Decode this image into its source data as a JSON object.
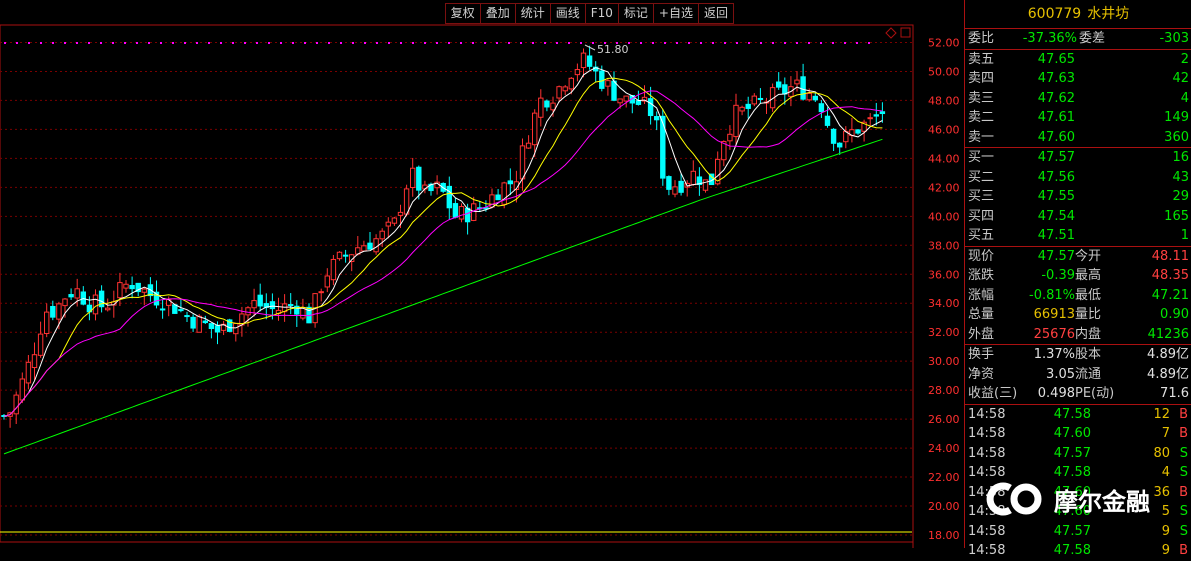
{
  "toolbar": {
    "buttons": [
      "复权",
      "叠加",
      "统计",
      "画线",
      "F10",
      "标记",
      "+自选",
      "返回"
    ]
  },
  "chart_data": {
    "type": "candlestick",
    "price_ticks": [
      "52.00",
      "50.00",
      "48.00",
      "46.00",
      "44.00",
      "42.00",
      "40.00",
      "38.00",
      "36.00",
      "34.00",
      "32.00",
      "30.00",
      "28.00",
      "26.00",
      "24.00",
      "22.00",
      "20.00",
      "18.00"
    ],
    "ylim": [
      18,
      53
    ],
    "high_label": "51.80",
    "colors": {
      "up": "#ff3232",
      "down": "#00ffff",
      "ma5": "#ffffff",
      "ma10": "#ffff00",
      "ma20": "#ff00ff",
      "ma60": "#00ff00",
      "grid": "#7a0000"
    }
  },
  "panel": {
    "code": "600779",
    "name": "水井坊",
    "weibi_label": "委比",
    "weibi": "-37.36%",
    "weicha_label": "委差",
    "weicha": "-303",
    "sell": [
      {
        "label": "卖五",
        "price": "47.65",
        "vol": "2"
      },
      {
        "label": "卖四",
        "price": "47.63",
        "vol": "42"
      },
      {
        "label": "卖三",
        "price": "47.62",
        "vol": "4"
      },
      {
        "label": "卖二",
        "price": "47.61",
        "vol": "149"
      },
      {
        "label": "卖一",
        "price": "47.60",
        "vol": "360"
      }
    ],
    "buy": [
      {
        "label": "买一",
        "price": "47.57",
        "vol": "16"
      },
      {
        "label": "买二",
        "price": "47.56",
        "vol": "43"
      },
      {
        "label": "买三",
        "price": "47.55",
        "vol": "29"
      },
      {
        "label": "买四",
        "price": "47.54",
        "vol": "165"
      },
      {
        "label": "买五",
        "price": "47.51",
        "vol": "1"
      }
    ],
    "quote": [
      {
        "l1": "现价",
        "v1": "47.57",
        "c1": "green",
        "l2": "今开",
        "v2": "48.11",
        "c2": "red"
      },
      {
        "l1": "涨跌",
        "v1": "-0.39",
        "c1": "green",
        "l2": "最高",
        "v2": "48.35",
        "c2": "red"
      },
      {
        "l1": "涨幅",
        "v1": "-0.81%",
        "c1": "green",
        "l2": "最低",
        "v2": "47.21",
        "c2": "green"
      },
      {
        "l1": "总量",
        "v1": "66913",
        "c1": "yel",
        "l2": "量比",
        "v2": "0.90",
        "c2": "green"
      },
      {
        "l1": "外盘",
        "v1": "25676",
        "c1": "red",
        "l2": "内盘",
        "v2": "41236",
        "c2": "green"
      }
    ],
    "stats": [
      {
        "l1": "换手",
        "v1": "1.37%",
        "l2": "股本",
        "v2": "4.89亿"
      },
      {
        "l1": "净资",
        "v1": "3.05",
        "l2": "流通",
        "v2": "4.89亿"
      },
      {
        "l1": "收益(三)",
        "v1": "0.498",
        "l2": "PE(动)",
        "v2": "71.6"
      }
    ],
    "ticks": [
      {
        "t": "14:58",
        "p": "47.58",
        "v": "12",
        "bs": "B"
      },
      {
        "t": "14:58",
        "p": "47.60",
        "v": "7",
        "bs": "B"
      },
      {
        "t": "14:58",
        "p": "47.57",
        "v": "80",
        "bs": "S"
      },
      {
        "t": "14:58",
        "p": "47.58",
        "v": "4",
        "bs": "S"
      },
      {
        "t": "14:58",
        "p": "47.60",
        "v": "36",
        "bs": "B"
      },
      {
        "t": "14:58",
        "p": "47.60",
        "v": "5",
        "bs": "S"
      },
      {
        "t": "14:58",
        "p": "47.57",
        "v": "9",
        "bs": "S"
      },
      {
        "t": "14:58",
        "p": "47.58",
        "v": "9",
        "bs": "B"
      }
    ]
  },
  "watermark": {
    "text": "摩尔金融"
  }
}
